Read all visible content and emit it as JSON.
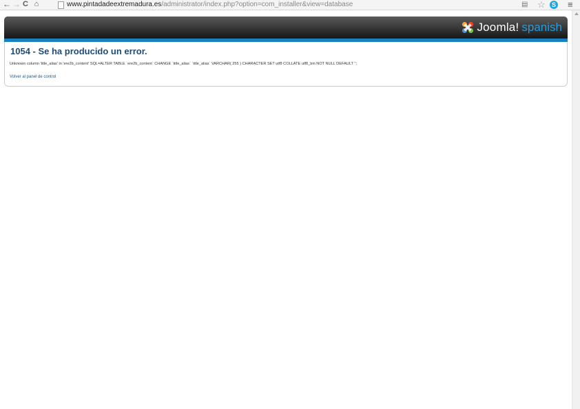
{
  "browser": {
    "url_host": "www.pintadadeextremadura.es",
    "url_path": "/administrator/index.php?option=com_installer&view=database",
    "icons": [
      "back-arrow-icon",
      "forward-arrow-icon",
      "reload-icon",
      "home-icon",
      "page-icon",
      "translate-icon",
      "star-icon",
      "skype-icon",
      "menu-icon"
    ]
  },
  "header": {
    "logo_text": "Joomla!",
    "logo_sub": "spanish",
    "accent_blue": "#1a7fbf"
  },
  "error": {
    "title": "1054 - Se ha producido un error.",
    "message": "Unknown column 'title_alias' in 'ere2b_content' SQL=ALTER TABLE `ere2b_content` CHANGE `title_alias` `title_alias` VARCHAR( 255 ) CHARACTER SET utf8 COLLATE utf8_bin NOT NULL DEFAULT '';",
    "link": "Volver al panel de control"
  }
}
